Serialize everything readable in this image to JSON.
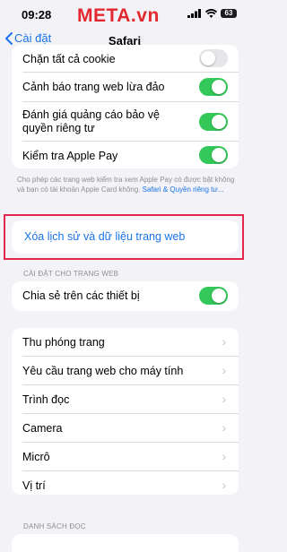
{
  "status": {
    "time": "09:28",
    "watermark": "META.vn",
    "battery": "63"
  },
  "nav": {
    "back_label": "Cài đặt",
    "title": "Safari"
  },
  "privacy": {
    "rows": [
      {
        "label": "Chặn tất cả cookie",
        "toggle": "off"
      },
      {
        "label": "Cảnh báo trang web lừa đảo",
        "toggle": "on"
      },
      {
        "label": "Đánh giá quảng cáo bảo vệ quyền riêng tư",
        "toggle": "on"
      },
      {
        "label": "Kiểm tra Apple Pay",
        "toggle": "on"
      }
    ],
    "footnote": "Cho phép các trang web kiểm tra xem Apple Pay có được bật không và bạn có tài khoản Apple Card không.",
    "footnote_link": "Safari & Quyền riêng tư..."
  },
  "clear_history": {
    "label": "Xóa lịch sử và dữ liệu trang web"
  },
  "website_settings": {
    "header": "CÀI ĐẶT CHO TRANG WEB",
    "share_label": "Chia sẻ trên các thiết bị",
    "share_toggle": "on"
  },
  "web_items": [
    {
      "label": "Thu phóng trang"
    },
    {
      "label": "Yêu cầu trang web cho máy tính"
    },
    {
      "label": "Trình đọc"
    },
    {
      "label": "Camera"
    },
    {
      "label": "Micrô"
    },
    {
      "label": "Vị trí"
    }
  ],
  "reading_list": {
    "header": "DANH SÁCH ĐỌC"
  },
  "colors": {
    "accent": "#1a73e8",
    "toggle_on": "#34c759",
    "highlight": "#e3284b"
  }
}
